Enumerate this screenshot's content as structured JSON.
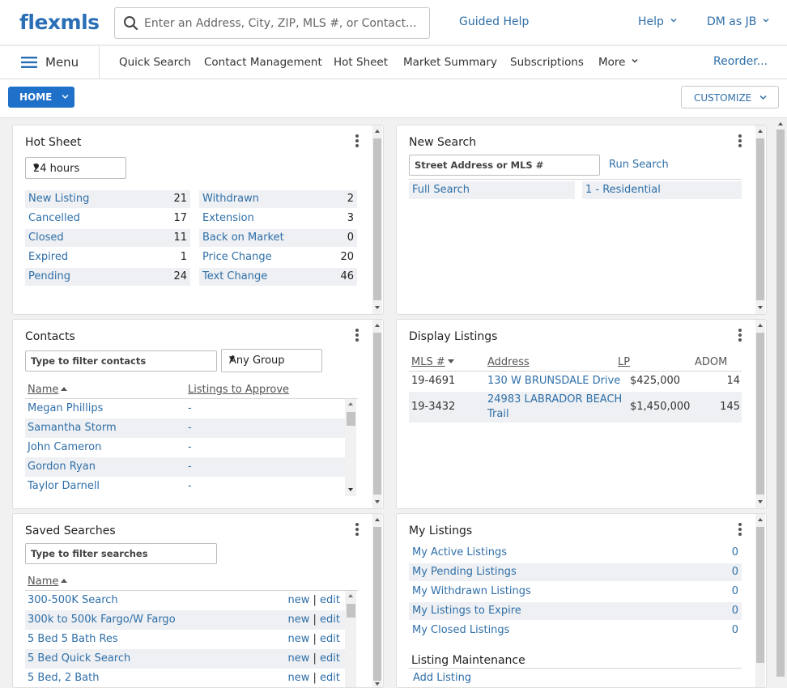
{
  "header": {
    "logo": "flexmls",
    "search_placeholder": "Enter an Address, City, ZIP, MLS #, or Contact...",
    "guided_help": "Guided Help",
    "help": "Help",
    "user": "DM as JB"
  },
  "nav": {
    "menu": "Menu",
    "items": [
      "Quick Search",
      "Contact Management",
      "Hot Sheet",
      "Market Summary",
      "Subscriptions",
      "More"
    ],
    "reorder": "Reorder..."
  },
  "toolbar": {
    "home": "HOME",
    "customize": "CUSTOMIZE"
  },
  "hot_sheet": {
    "title": "Hot Sheet",
    "period": "24 hours",
    "left": [
      {
        "label": "New Listing",
        "count": "21"
      },
      {
        "label": "Cancelled",
        "count": "17"
      },
      {
        "label": "Closed",
        "count": "11"
      },
      {
        "label": "Expired",
        "count": "1"
      },
      {
        "label": "Pending",
        "count": "24"
      }
    ],
    "right": [
      {
        "label": "Withdrawn",
        "count": "2"
      },
      {
        "label": "Extension",
        "count": "3"
      },
      {
        "label": "Back on Market",
        "count": "0"
      },
      {
        "label": "Price Change",
        "count": "20"
      },
      {
        "label": "Text Change",
        "count": "46"
      }
    ]
  },
  "new_search": {
    "title": "New Search",
    "input_placeholder": "Street Address or MLS #",
    "run": "Run Search",
    "full_search": "Full Search",
    "residential": "1 - Residential"
  },
  "contacts": {
    "title": "Contacts",
    "filter_placeholder": "Type to filter contacts",
    "group": "Any Group",
    "col_name": "Name",
    "col_listings": "Listings to Approve",
    "rows": [
      {
        "name": "Megan Phillips",
        "value": "-"
      },
      {
        "name": "Samantha Storm",
        "value": "-"
      },
      {
        "name": "John Cameron",
        "value": "-"
      },
      {
        "name": "Gordon Ryan",
        "value": "-"
      },
      {
        "name": "Taylor Darnell",
        "value": "-"
      }
    ]
  },
  "display_listings": {
    "title": "Display Listings",
    "cols": {
      "mls": "MLS #",
      "address": "Address",
      "lp": "LP",
      "adom": "ADOM"
    },
    "rows": [
      {
        "mls": "19-4691",
        "address": "130 W BRUNSDALE Drive",
        "address2": "",
        "lp": "$425,000",
        "adom": "14"
      },
      {
        "mls": "19-3432",
        "address": "24983 LABRADOR BEACH",
        "address2": "Trail",
        "lp": "$1,450,000",
        "adom": "145"
      }
    ]
  },
  "saved_searches": {
    "title": "Saved Searches",
    "filter_placeholder": "Type to filter searches",
    "col_name": "Name",
    "new_label": "new",
    "sep": "|",
    "edit_label": "edit",
    "rows": [
      "300-500K Search",
      "300k to 500k Fargo/W Fargo",
      "5 Bed 5 Bath Res",
      "5 Bed Quick Search",
      "5 Bed, 2 Bath"
    ]
  },
  "my_listings": {
    "title": "My Listings",
    "rows": [
      {
        "label": "My Active Listings",
        "count": "0"
      },
      {
        "label": "My Pending Listings",
        "count": "0"
      },
      {
        "label": "My Withdrawn Listings",
        "count": "0"
      },
      {
        "label": "My Listings to Expire",
        "count": "0"
      },
      {
        "label": "My Closed Listings",
        "count": "0"
      }
    ],
    "maintenance_title": "Listing Maintenance",
    "add_listing": "Add Listing"
  },
  "colors": {
    "brand": "#2a6fb6",
    "link": "#2f6fa8",
    "home_button": "#1f70c8",
    "row_alt": "#eef0f3"
  },
  "icons": [
    "search-icon",
    "chevron-down-icon",
    "hamburger-icon",
    "kebab-icon",
    "sort-asc-icon",
    "sort-desc-icon",
    "scroll-up-icon",
    "scroll-down-icon"
  ]
}
